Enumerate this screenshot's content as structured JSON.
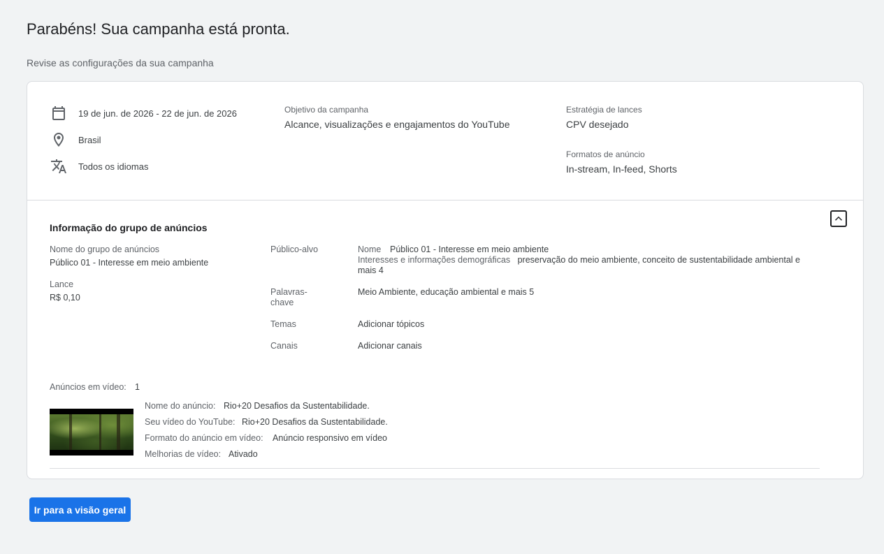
{
  "header": {
    "title": "Parabéns! Sua campanha está pronta.",
    "subtitle": "Revise as configurações da sua campanha"
  },
  "summary": {
    "dates": "19 de jun. de 2026 - 22 de jun. de 2026",
    "location": "Brasil",
    "languages": "Todos os idiomas",
    "objective_label": "Objetivo da campanha",
    "objective_value": "Alcance, visualizações e engajamentos do YouTube",
    "bidding_label": "Estratégia de lances",
    "bidding_value": "CPV desejado",
    "formats_label": "Formatos de anúncio",
    "formats_value": "In-stream, In-feed, Shorts",
    "icons": [
      "calendar-icon",
      "location-pin-icon",
      "translate-icon"
    ]
  },
  "ad_group": {
    "section_title": "Informação do grupo de anúncios",
    "name_label": "Nome do grupo de anúncios",
    "name_value": "Público 01 - Interesse em meio ambiente",
    "bid_label": "Lance",
    "bid_value": "R$ 0,10",
    "audience_label": "Público-alvo",
    "audience_name_key": "Nome",
    "audience_name_value": "Público 01 - Interesse em meio ambiente",
    "audience_interests_key": "Interesses e informações demográficas",
    "audience_interests_value": "preservação do meio ambiente, conceito de sustentabilidade ambiental e mais 4",
    "keywords_label_line1": "Palavras-",
    "keywords_label_line2": "chave",
    "keywords_value": "Meio Ambiente, educação ambiental e mais 5",
    "topics_label": "Temas",
    "topics_value": "Adicionar tópicos",
    "channels_label": "Canais",
    "channels_value": "Adicionar canais"
  },
  "video_ads": {
    "count_label": "Anúncios em vídeo:",
    "count_value": "1",
    "ad_name_label": "Nome do anúncio:",
    "ad_name_value": "Rio+20 Desafios da Sustentabilidade.",
    "youtube_label": "Seu vídeo do YouTube:",
    "youtube_value": "Rio+20 Desafios da Sustentabilidade.",
    "format_label": "Formato do anúncio em vídeo:",
    "format_value": "Anúncio responsivo em vídeo",
    "enhancements_label": "Melhorias de vídeo:",
    "enhancements_value": "Ativado"
  },
  "actions": {
    "overview_button": "Ir para a visão geral"
  },
  "colors": {
    "primary": "#1a73e8",
    "background": "#f1f3f4",
    "card": "#ffffff",
    "border": "#dadce0"
  }
}
